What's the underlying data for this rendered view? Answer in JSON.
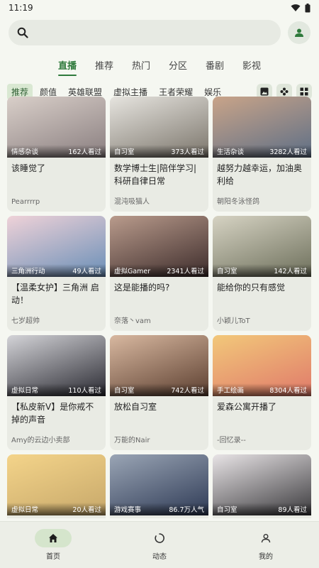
{
  "status": {
    "time": "11:19"
  },
  "search": {
    "placeholder": ""
  },
  "main_tabs": [
    "直播",
    "推荐",
    "热门",
    "分区",
    "番剧",
    "影视"
  ],
  "sub_categories": [
    "推荐",
    "颜值",
    "英雄联盟",
    "虚拟主播",
    "王者荣耀",
    "娱乐"
  ],
  "cards": [
    {
      "title": "该睡觉了",
      "author": "Pearrrrp",
      "category": "情感杂谈",
      "views": "162人看过",
      "colors": [
        "#d9cfc9",
        "#8a7f80"
      ]
    },
    {
      "title": "数学博士生|陪伴学习|科研自律日常",
      "author": "混沌吸猫人",
      "category": "自习室",
      "views": "373人看过",
      "colors": [
        "#e6e4df",
        "#7b756b"
      ]
    },
    {
      "title": "越努力越幸运，加油奥利给",
      "author": "朝阳冬泳怪鸽",
      "category": "生活杂谈",
      "views": "3282人看过",
      "colors": [
        "#c9a489",
        "#5e6f86"
      ]
    },
    {
      "title": "【温柔女护】三角洲 启动！",
      "author": "七岁超帅",
      "category": "三角洲行动",
      "views": "49人看过",
      "colors": [
        "#efd2d8",
        "#6a8fb7"
      ]
    },
    {
      "title": "这是能播的吗?",
      "author": "奈落丶vam",
      "category": "虚拟Gamer",
      "views": "2341人看过",
      "colors": [
        "#b99b8c",
        "#3d2c2b"
      ]
    },
    {
      "title": "能给你的只有感觉",
      "author": "小颖儿ToT",
      "category": "自习室",
      "views": "142人看过",
      "colors": [
        "#d6d3c3",
        "#6d6f5b"
      ]
    },
    {
      "title": "【私皮新V】是你戒不掉的声音",
      "author": "Amy的云边小卖部",
      "category": "虚拟日常",
      "views": "110人看过",
      "colors": [
        "#d4d4d8",
        "#2a2a32"
      ]
    },
    {
      "title": "放松自习室",
      "author": "万能的Nair",
      "category": "自习室",
      "views": "742人看过",
      "colors": [
        "#d8b8a0",
        "#5c3f30"
      ]
    },
    {
      "title": "爱森公寓开播了",
      "author": "-回忆录--",
      "category": "手工绘画",
      "views": "8304人看过",
      "colors": [
        "#f2c87a",
        "#e07a6a"
      ]
    },
    {
      "title": "",
      "author": "",
      "category": "虚拟日常",
      "views": "20人看过",
      "colors": [
        "#f4d48a",
        "#c7a86a"
      ]
    },
    {
      "title": "",
      "author": "",
      "category": "游戏赛事",
      "views": "86.7万人气",
      "colors": [
        "#9aa5b5",
        "#2e3a55"
      ]
    },
    {
      "title": "",
      "author": "",
      "category": "自习室",
      "views": "89人看过",
      "colors": [
        "#e8e4e6",
        "#3b3a3d"
      ]
    }
  ],
  "bottom_nav": [
    "首页",
    "动态",
    "我的"
  ]
}
